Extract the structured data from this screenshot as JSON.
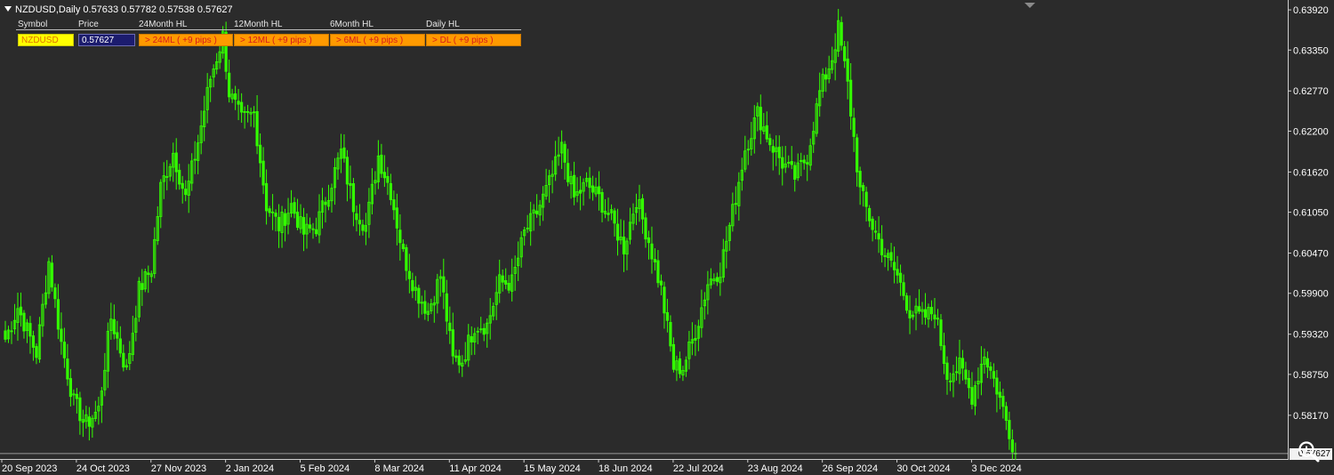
{
  "window": {
    "title": "NZDUSD,Daily  0.57633 0.57782 0.57538 0.57627"
  },
  "info_panel": {
    "headers": [
      "Symbol",
      "Price",
      "24Month  HL",
      "12Month  HL",
      "6Month  HL",
      "Daily  HL"
    ],
    "symbol": "NZDUSD",
    "price": "0.57627",
    "cells": [
      "> 24ML ( +9 pips )",
      "> 12ML ( +9 pips )",
      "> 6ML ( +9 pips )",
      "> DL ( +9 pips )"
    ]
  },
  "colors": {
    "background": "#2b2b2b",
    "candle": "#33ff00",
    "axis_text": "#ffffff",
    "axis_line": "#cfcfcf",
    "price_line": "#9a9a9a",
    "price_tag_bg": "#f2f2f2",
    "symbol_bg": "#ffff00",
    "price_bg": "#1c1c6e",
    "orange_bg": "#ff9a00"
  },
  "icons": {
    "dropdown": "triangle-down-icon",
    "zoom": "zoom-icon",
    "scroll": "scroll-marker-icon"
  },
  "chart_data": {
    "type": "candlestick",
    "symbol": "NZDUSD",
    "timeframe": "Daily",
    "last_bar": {
      "open": 0.57633,
      "high": 0.57782,
      "low": 0.57538,
      "close": 0.57627
    },
    "current_price": 0.57627,
    "price_tag_label": "0.57627",
    "ylim": [
      0.5755,
      0.6406
    ],
    "y_ticks": [
      {
        "value": 0.6392,
        "label": "0.63920"
      },
      {
        "value": 0.6335,
        "label": "0.63350"
      },
      {
        "value": 0.6277,
        "label": "0.62770"
      },
      {
        "value": 0.622,
        "label": "0.62200"
      },
      {
        "value": 0.6162,
        "label": "0.61620"
      },
      {
        "value": 0.6105,
        "label": "0.61050"
      },
      {
        "value": 0.6047,
        "label": "0.60470"
      },
      {
        "value": 0.599,
        "label": "0.59900"
      },
      {
        "value": 0.5932,
        "label": "0.59320"
      },
      {
        "value": 0.5875,
        "label": "0.58750"
      },
      {
        "value": 0.5817,
        "label": "0.58170"
      }
    ],
    "x_ticks": [
      {
        "label": "20 Sep 2023",
        "bar_index": 0
      },
      {
        "label": "24 Oct 2023",
        "bar_index": 24
      },
      {
        "label": "27 Nov 2023",
        "bar_index": 48
      },
      {
        "label": "2 Jan 2024",
        "bar_index": 72
      },
      {
        "label": "5 Feb 2024",
        "bar_index": 96
      },
      {
        "label": "8 Mar 2024",
        "bar_index": 120
      },
      {
        "label": "11 Apr 2024",
        "bar_index": 144
      },
      {
        "label": "15 May 2024",
        "bar_index": 168
      },
      {
        "label": "18 Jun 2024",
        "bar_index": 192
      },
      {
        "label": "22 Jul 2024",
        "bar_index": 216
      },
      {
        "label": "23 Aug 2024",
        "bar_index": 240
      },
      {
        "label": "26 Sep 2024",
        "bar_index": 264
      },
      {
        "label": "30 Oct 2024",
        "bar_index": 288
      },
      {
        "label": "3 Dec 2024",
        "bar_index": 312
      }
    ],
    "close_path_keypoints": [
      {
        "bar": 0,
        "price": 0.5925
      },
      {
        "bar": 4,
        "price": 0.597
      },
      {
        "bar": 10,
        "price": 0.5905
      },
      {
        "bar": 14,
        "price": 0.6035
      },
      {
        "bar": 18,
        "price": 0.592
      },
      {
        "bar": 22,
        "price": 0.5835
      },
      {
        "bar": 26,
        "price": 0.5805
      },
      {
        "bar": 30,
        "price": 0.5825
      },
      {
        "bar": 34,
        "price": 0.5955
      },
      {
        "bar": 39,
        "price": 0.588
      },
      {
        "bar": 43,
        "price": 0.5995
      },
      {
        "bar": 47,
        "price": 0.6025
      },
      {
        "bar": 50,
        "price": 0.614
      },
      {
        "bar": 54,
        "price": 0.619
      },
      {
        "bar": 58,
        "price": 0.6125
      },
      {
        "bar": 62,
        "price": 0.6205
      },
      {
        "bar": 66,
        "price": 0.6295
      },
      {
        "bar": 70,
        "price": 0.6355
      },
      {
        "bar": 72,
        "price": 0.6275
      },
      {
        "bar": 76,
        "price": 0.6235
      },
      {
        "bar": 80,
        "price": 0.6245
      },
      {
        "bar": 84,
        "price": 0.6115
      },
      {
        "bar": 88,
        "price": 0.6085
      },
      {
        "bar": 92,
        "price": 0.6115
      },
      {
        "bar": 96,
        "price": 0.6075
      },
      {
        "bar": 100,
        "price": 0.6085
      },
      {
        "bar": 104,
        "price": 0.6135
      },
      {
        "bar": 108,
        "price": 0.619
      },
      {
        "bar": 112,
        "price": 0.6115
      },
      {
        "bar": 116,
        "price": 0.6085
      },
      {
        "bar": 120,
        "price": 0.6185
      },
      {
        "bar": 124,
        "price": 0.6135
      },
      {
        "bar": 128,
        "price": 0.6045
      },
      {
        "bar": 132,
        "price": 0.5995
      },
      {
        "bar": 136,
        "price": 0.5965
      },
      {
        "bar": 140,
        "price": 0.6015
      },
      {
        "bar": 144,
        "price": 0.5895
      },
      {
        "bar": 147,
        "price": 0.5895
      },
      {
        "bar": 151,
        "price": 0.5945
      },
      {
        "bar": 155,
        "price": 0.5945
      },
      {
        "bar": 159,
        "price": 0.6005
      },
      {
        "bar": 163,
        "price": 0.6005
      },
      {
        "bar": 167,
        "price": 0.6075
      },
      {
        "bar": 171,
        "price": 0.6105
      },
      {
        "bar": 175,
        "price": 0.6145
      },
      {
        "bar": 179,
        "price": 0.6195
      },
      {
        "bar": 183,
        "price": 0.6125
      },
      {
        "bar": 187,
        "price": 0.6145
      },
      {
        "bar": 191,
        "price": 0.6125
      },
      {
        "bar": 195,
        "price": 0.6095
      },
      {
        "bar": 199,
        "price": 0.6055
      },
      {
        "bar": 203,
        "price": 0.6125
      },
      {
        "bar": 207,
        "price": 0.6065
      },
      {
        "bar": 211,
        "price": 0.5995
      },
      {
        "bar": 215,
        "price": 0.5885
      },
      {
        "bar": 218,
        "price": 0.5885
      },
      {
        "bar": 222,
        "price": 0.5935
      },
      {
        "bar": 226,
        "price": 0.6005
      },
      {
        "bar": 230,
        "price": 0.6025
      },
      {
        "bar": 234,
        "price": 0.6105
      },
      {
        "bar": 238,
        "price": 0.6195
      },
      {
        "bar": 242,
        "price": 0.6245
      },
      {
        "bar": 246,
        "price": 0.6205
      },
      {
        "bar": 250,
        "price": 0.6175
      },
      {
        "bar": 254,
        "price": 0.6155
      },
      {
        "bar": 258,
        "price": 0.6185
      },
      {
        "bar": 262,
        "price": 0.6275
      },
      {
        "bar": 266,
        "price": 0.6325
      },
      {
        "bar": 268,
        "price": 0.6365
      },
      {
        "bar": 271,
        "price": 0.6285
      },
      {
        "bar": 275,
        "price": 0.6135
      },
      {
        "bar": 279,
        "price": 0.6085
      },
      {
        "bar": 283,
        "price": 0.6045
      },
      {
        "bar": 287,
        "price": 0.6015
      },
      {
        "bar": 291,
        "price": 0.5965
      },
      {
        "bar": 295,
        "price": 0.5955
      },
      {
        "bar": 299,
        "price": 0.5965
      },
      {
        "bar": 303,
        "price": 0.5875
      },
      {
        "bar": 307,
        "price": 0.5885
      },
      {
        "bar": 311,
        "price": 0.5845
      },
      {
        "bar": 315,
        "price": 0.5905
      },
      {
        "bar": 319,
        "price": 0.5855
      },
      {
        "bar": 323,
        "price": 0.5795
      },
      {
        "bar": 325,
        "price": 0.57627
      }
    ]
  }
}
